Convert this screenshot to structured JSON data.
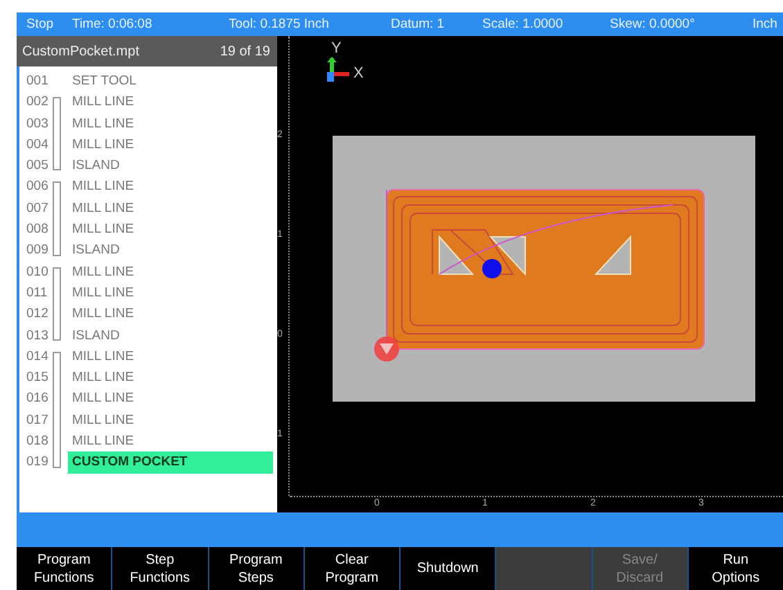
{
  "status_bar": [
    "Stop",
    "Time: 0:06:08",
    "Tool: 0.1875 Inch",
    "Datum: 1",
    "Scale: 1.0000",
    "Skew: 0.0000°",
    "Inch"
  ],
  "program": {
    "file": "CustomPocket.mpt",
    "position": "19 of 19",
    "steps": [
      {
        "number": "001",
        "label": "SET TOOL",
        "kind": "single",
        "selected": false
      },
      {
        "number": "002",
        "label": "MILL LINE",
        "kind": "group-start",
        "selected": false
      },
      {
        "number": "003",
        "label": "MILL LINE",
        "kind": "group-mid",
        "selected": false
      },
      {
        "number": "004",
        "label": "MILL LINE",
        "kind": "group-mid",
        "selected": false
      },
      {
        "number": "005",
        "label": "ISLAND",
        "kind": "group-end",
        "selected": false
      },
      {
        "number": "006",
        "label": "MILL LINE",
        "kind": "group-start",
        "selected": false
      },
      {
        "number": "007",
        "label": "MILL LINE",
        "kind": "group-mid",
        "selected": false
      },
      {
        "number": "008",
        "label": "MILL LINE",
        "kind": "group-mid",
        "selected": false
      },
      {
        "number": "009",
        "label": "ISLAND",
        "kind": "group-end",
        "selected": false
      },
      {
        "number": "010",
        "label": "MILL LINE",
        "kind": "group-start",
        "selected": false
      },
      {
        "number": "011",
        "label": "MILL LINE",
        "kind": "group-mid",
        "selected": false
      },
      {
        "number": "012",
        "label": "MILL LINE",
        "kind": "group-mid",
        "selected": false
      },
      {
        "number": "013",
        "label": "ISLAND",
        "kind": "group-end",
        "selected": false
      },
      {
        "number": "014",
        "label": "MILL LINE",
        "kind": "group-start",
        "selected": false
      },
      {
        "number": "015",
        "label": "MILL LINE",
        "kind": "group-mid",
        "selected": false
      },
      {
        "number": "016",
        "label": "MILL LINE",
        "kind": "group-mid",
        "selected": false
      },
      {
        "number": "017",
        "label": "MILL LINE",
        "kind": "group-mid",
        "selected": false
      },
      {
        "number": "018",
        "label": "MILL LINE",
        "kind": "group-mid",
        "selected": false
      },
      {
        "number": "019",
        "label": "CUSTOM POCKET",
        "kind": "group-end",
        "selected": true
      }
    ]
  },
  "view": {
    "axis_labels": [
      "Y",
      "X"
    ],
    "y_ruler": [
      "2",
      "1",
      "0",
      "1"
    ],
    "x_ruler": [
      "0",
      "1",
      "2",
      "3"
    ]
  },
  "softkeys": [
    {
      "lines": [
        "Program",
        "Functions"
      ],
      "kind": "key",
      "disabled": false
    },
    {
      "lines": [
        "Step",
        "Functions"
      ],
      "kind": "key",
      "disabled": false
    },
    {
      "lines": [
        "Program",
        "Steps"
      ],
      "kind": "key",
      "disabled": false
    },
    {
      "lines": [
        "Clear",
        "Program"
      ],
      "kind": "key",
      "disabled": false
    },
    {
      "lines": [
        "Shutdown"
      ],
      "kind": "key",
      "disabled": false
    },
    {
      "kind": "blank"
    },
    {
      "lines": [
        "Save/",
        "Discard"
      ],
      "kind": "key",
      "disabled": true
    },
    {
      "lines": [
        "Run",
        "Options"
      ],
      "kind": "key",
      "disabled": false
    }
  ]
}
